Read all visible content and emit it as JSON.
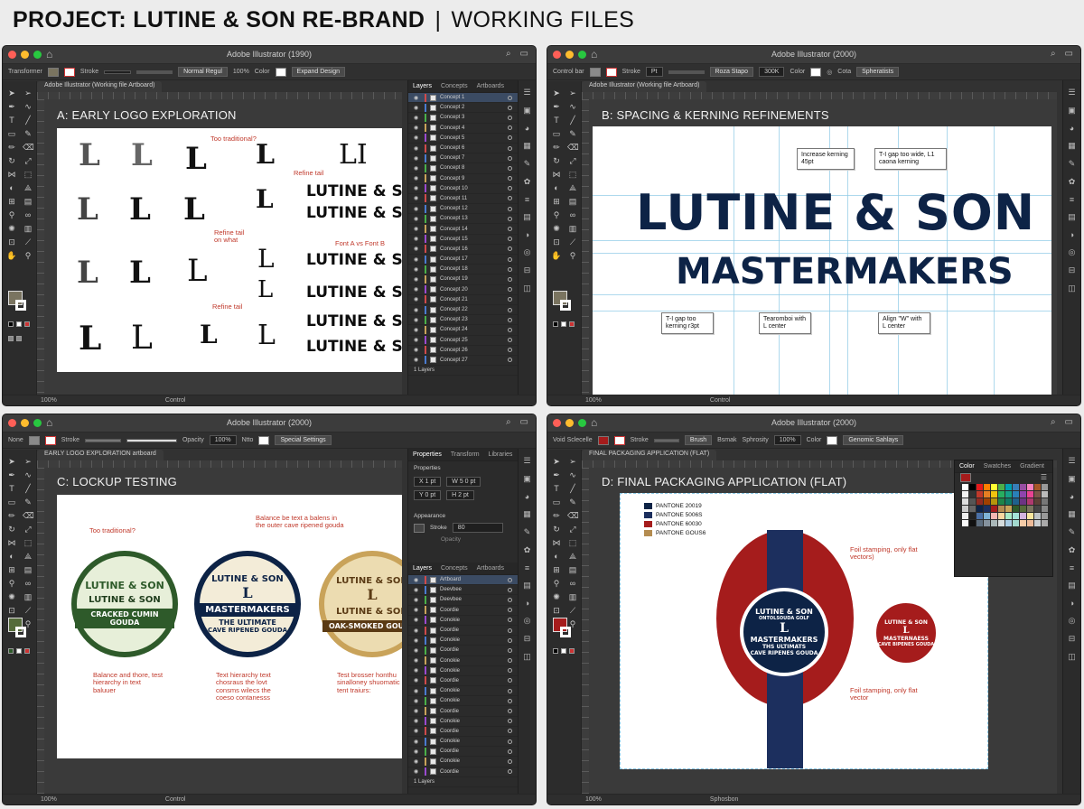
{
  "page": {
    "title_bold": "PROJECT: LUTINE & SON RE-BRAND",
    "separator": "|",
    "title_rest": "WORKING FILES"
  },
  "windows": [
    {
      "app_title": "Adobe Illustrator (1990)",
      "doc_tab": "Adobe Illustrator (Working file Artboard)",
      "canvas_label": "A: EARLY LOGO EXPLORATION",
      "ctrl": {
        "label": "Transformer",
        "style": "Stroke",
        "mode": "Normal Regul",
        "quality": "100%",
        "color": "Color",
        "btn": "Expand Design"
      },
      "status": {
        "zoom": "100%",
        "center": "Control"
      },
      "panel_tabs": [
        "Layers",
        "Concepts",
        "Artboards"
      ],
      "layers": [
        "Concept 1",
        "Concept 2",
        "Concept 3",
        "Concept 4",
        "Concept 5",
        "Concept 6",
        "Concept 7",
        "Concept 8",
        "Concept 9",
        "Concept 10",
        "Concept 11",
        "Concept 12",
        "Concept 13",
        "Concept 14",
        "Concept 15",
        "Concept 16",
        "Concept 17",
        "Concept 18",
        "Concept 19",
        "Concept 20",
        "Concept 21",
        "Concept 22",
        "Concept 23",
        "Concept 24",
        "Concept 25",
        "Concept 26",
        "Concept 27"
      ],
      "layers_footer": "1 Layers",
      "notes": {
        "too_traditional": "Too traditional?",
        "refine_tail_1": "Refine tail",
        "refine_tail_2": "Refine tail on what",
        "refine_tail_3": "Refine tail",
        "font_ab": "Font A vs Font B"
      },
      "glyph_letter": "L",
      "glyph_li": "LI",
      "wordmarks": [
        "LUTINE & SON",
        "LUTINE & SON",
        "LUTINE & SON",
        "LUTINE & SON",
        "LUTINE & SON",
        "LUTINE & SON"
      ]
    },
    {
      "app_title": "Adobe Illustrator (2000)",
      "canvas_label": "B: SPACING & KERNING REFINEMENTS",
      "doc_tab": "Adobe Illustrator (Working file Artboard)",
      "ctrl": {
        "label": "Control bar",
        "style": "Stroke",
        "pt": "Pt",
        "mode": "Roza Stapo",
        "quality": "300K",
        "color": "Color",
        "c2": "Cota",
        "btn": "Spheratists"
      },
      "status": {
        "zoom": "100%",
        "center": "Control"
      },
      "headline": "LUTINE & SON",
      "subline": "MASTERMAKERS",
      "callouts": {
        "c1": "Increase kerning 45pt",
        "c2": "T-I gap too wide, L1 caona kerning",
        "c3": "T-I gap too kerning r3pt",
        "c4": "Tearomboi with L center",
        "c5": "Align \"W\" with L center"
      }
    },
    {
      "app_title": "Adobe Illustrator (2000)",
      "canvas_label": "C: LOCKUP TESTING",
      "doc_tab": "EARLY LOGO EXPLORATION artboard",
      "ctrl": {
        "label": "None",
        "style": "Stroke",
        "opacity": "Opacity",
        "val": "100%",
        "mode": "Ntto",
        "btn": "Special Settings"
      },
      "status": {
        "zoom": "100%",
        "center": "Control"
      },
      "panel_tabs": [
        "Properties",
        "Transform",
        "Libraries"
      ],
      "props": {
        "section": "Properties",
        "x": "X 1 pt",
        "y": "Y 0 pt",
        "w": "W 5 0 pt",
        "h": "H 2 pt",
        "appearance": "Appearance",
        "stroke": "Stroke",
        "stroke_val": "80",
        "opacity": "Opacity"
      },
      "layer_tabs": [
        "Layers",
        "Concepts",
        "Artboards"
      ],
      "layers": [
        "Artboard",
        "Deevbee",
        "Deevbee",
        "Coordie",
        "Conokie",
        "Coordie",
        "Conokie",
        "Coordie",
        "Conokie",
        "Conokie",
        "Coordie",
        "Conokie",
        "Conokie",
        "Coordie",
        "Conokie",
        "Coordie",
        "Conokie",
        "Coordie",
        "Conokie",
        "Coordie"
      ],
      "layers_footer": "1 Layers",
      "badges": [
        {
          "top": "LUTINE & SON",
          "mid": "LUTINE & SON",
          "bot": "CRACKED CUMIN GOUDA",
          "tiny": ""
        },
        {
          "top": "LUTINE & SON",
          "letter": "L",
          "mid": "MASTERMAKERS",
          "sub": "THE ULTIMATE",
          "bot": "CAVE RIPENED GOUDA"
        },
        {
          "top": "LUTINE & SON",
          "letter": "L",
          "mid": "LUTINE & SON",
          "bot": "OAK-SMOKED GOUDA"
        }
      ],
      "notes": {
        "n1": "Too traditional?",
        "n2": "Balance be text a balens in the outer cave ripened gouda",
        "n3": "Balance and thore, test hierarchy in text baluuer",
        "n4": "Text hierarchy text chosraus the lovt consms wilecs the coeso contanesss",
        "n5": "Test brosser honthu sinalloney shuomatic tent traiurs:"
      }
    },
    {
      "app_title": "Adobe Illustrator (2000)",
      "canvas_label": "D: FINAL PACKAGING APPLICATION (FLAT)",
      "doc_tab": "FINAL PACKAGING APPLICATION (FLAT)",
      "ctrl": {
        "label": "Void Sclecelle",
        "style": "Stroke",
        "mode": "Brush",
        "quality": "Bsmak",
        "opacity": "Sphrosity",
        "val": "100%",
        "color": "Color",
        "btn": "Genomic Sahlays"
      },
      "status": {
        "zoom": "100%",
        "center": "Sphosbon"
      },
      "swatch_tabs": [
        "Color",
        "Swatches",
        "Gradient"
      ],
      "pantones": [
        "PANTONE 20019",
        "PANTONE 5006S",
        "PANTONE 60030",
        "PANTONE GOUS6"
      ],
      "pantone_colors": [
        "#0d2346",
        "#1c2f5e",
        "#a51c1c",
        "#b48c50"
      ],
      "big_label": {
        "top": "LUTINE & SON",
        "tiny": "ONTOLSOUDA GOLF",
        "letter": "L",
        "mid": "MASTERMAKERS",
        "sub": "THS ULTIMATS",
        "bot": "CAVE RIPENES GOUDA"
      },
      "small_label": {
        "top": "LUTINE & SON",
        "letter": "L",
        "mid": "MASTERNAESS",
        "bot": "CAVE BIPENES GOUDA"
      },
      "notes": {
        "n1": "Foil stamping, only flat vectors)",
        "n2": "Foil stamping, only flat vector"
      }
    }
  ],
  "colors": {
    "navy": "#0d2346",
    "red": "#a51c1c",
    "green": "#2e5a2a",
    "gold": "#c9a35a",
    "note_red": "#c0392b"
  }
}
